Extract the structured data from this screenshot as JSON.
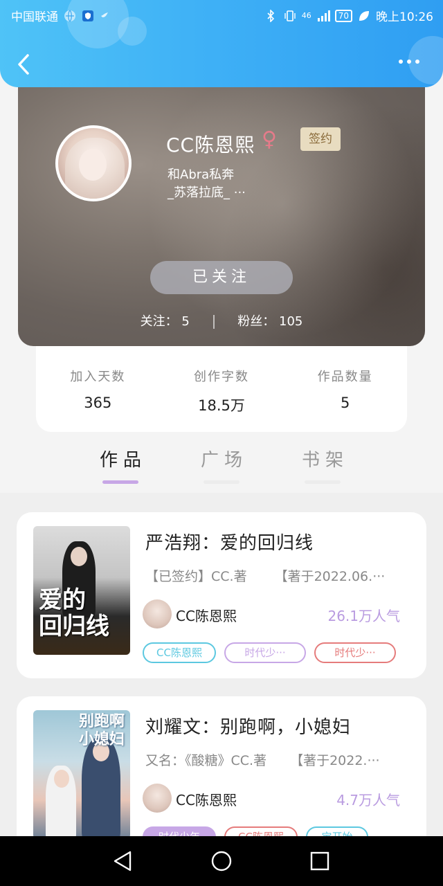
{
  "status_bar": {
    "carrier": "中国联通",
    "network": "46",
    "battery": "70",
    "time": "晚上10:26"
  },
  "header": {
    "back_icon": "chevron-left-icon",
    "more_icon": "more-dots-icon"
  },
  "profile": {
    "name": "CC陈恩熙",
    "gender_symbol": "♀",
    "gender_color": "#e57b8a",
    "signed_badge": "签约",
    "bio_line1": "和Abra私奔",
    "bio_line2": "_苏落拉底_  ···",
    "followed_button": "已关注",
    "following_label": "关注：",
    "following_count": "5",
    "followers_label": "粉丝：",
    "followers_count": "105"
  },
  "stats": [
    {
      "label": "加入天数",
      "value": "365"
    },
    {
      "label": "创作字数",
      "value": "18.5万"
    },
    {
      "label": "作品数量",
      "value": "5"
    }
  ],
  "tabs": [
    {
      "label": "作品",
      "active": true
    },
    {
      "label": "广场",
      "active": false
    },
    {
      "label": "书架",
      "active": false
    }
  ],
  "accent_color": "#c7a7e6",
  "works": [
    {
      "title": "严浩翔：爱的回归线",
      "meta1": "【已签约】CC.著",
      "meta2": "【著于2022.06.···",
      "cover_text": "爱的\n回归线",
      "author": "CC陈恩熙",
      "popularity": "26.1万人气",
      "tags": [
        {
          "text": "CC陈恩熙",
          "color": "#5cc8e0"
        },
        {
          "text": "时代少···",
          "color": "#c7a7e6"
        },
        {
          "text": "时代少···",
          "color": "#e57b7b"
        }
      ]
    },
    {
      "title": "刘耀文：别跑啊，小媳妇",
      "meta1": "又名：《酸糖》CC.著",
      "meta2": "【著于2022.···",
      "cover_text": "别跑啊\n小媳妇",
      "author": "CC陈恩熙",
      "popularity": "4.7万人气",
      "tags": [
        {
          "text": "时代少年",
          "color": "#c7a7e6"
        },
        {
          "text": "CC陈恩熙",
          "color": "#e57b7b"
        },
        {
          "text": "宝开始",
          "color": "#5cc8e0"
        }
      ]
    }
  ],
  "nav": {
    "back": "back-triangle-icon",
    "home": "home-circle-icon",
    "recent": "recent-square-icon"
  }
}
